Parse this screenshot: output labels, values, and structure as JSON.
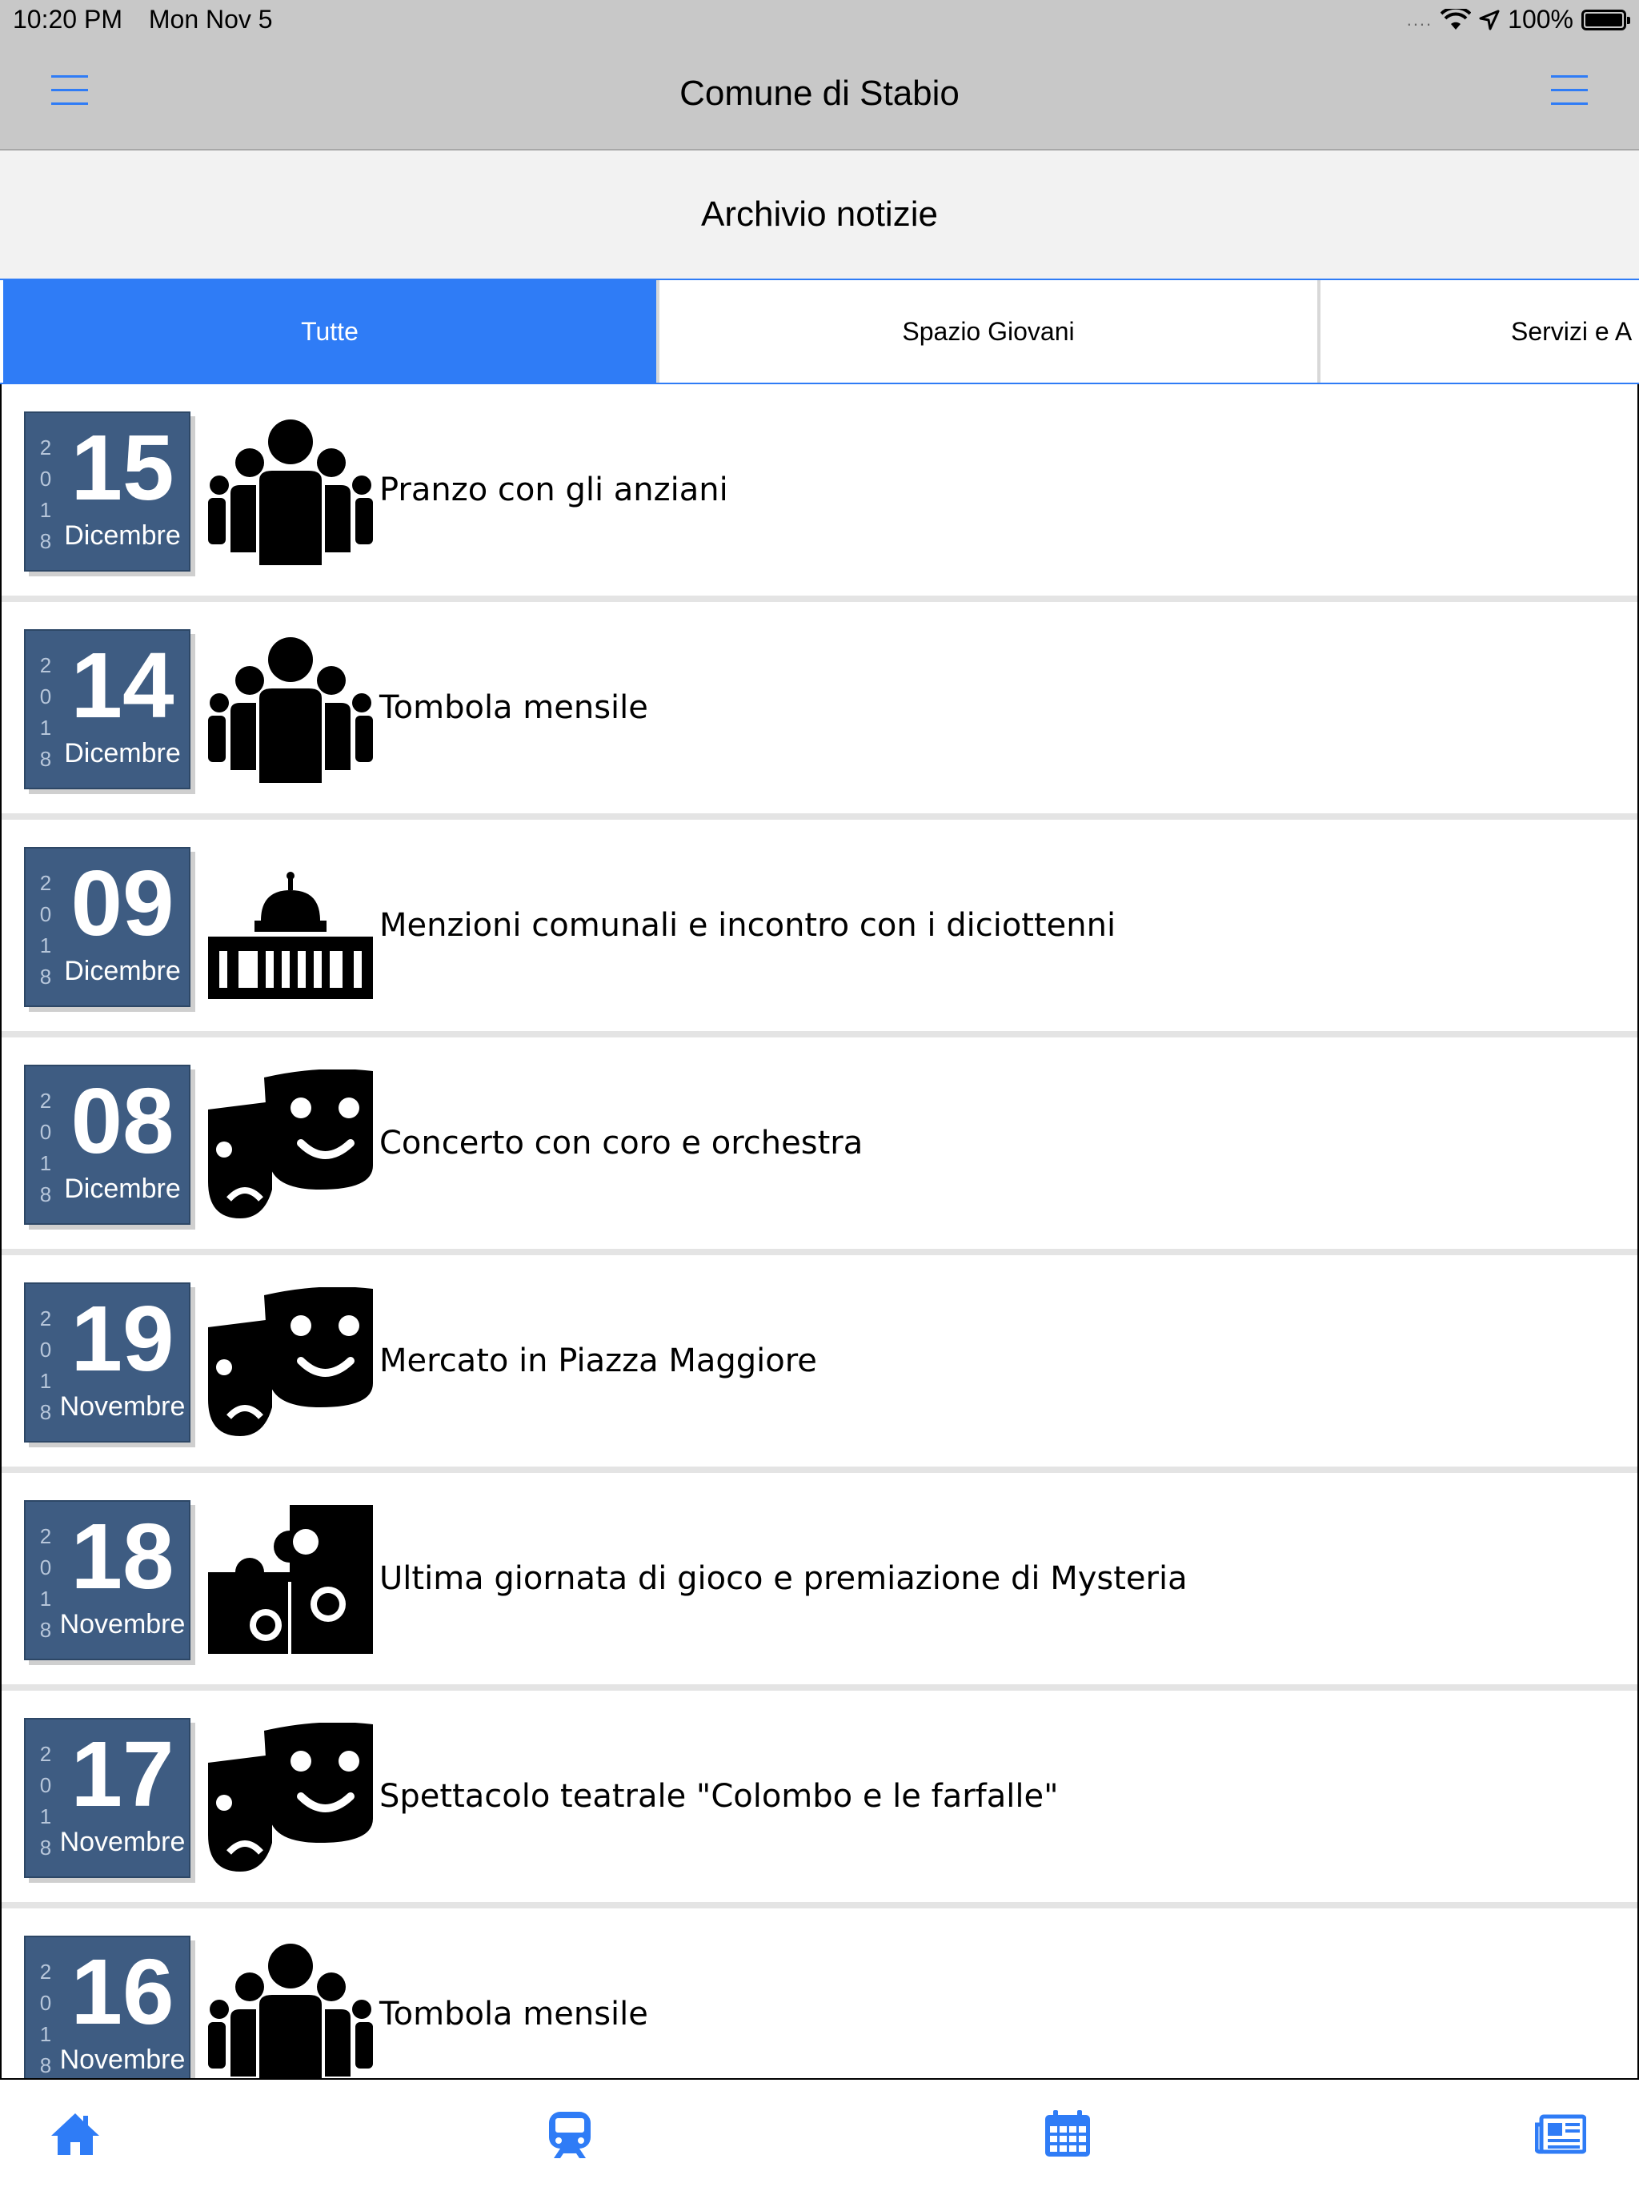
{
  "status_bar": {
    "time": "10:20 PM",
    "date": "Mon Nov 5",
    "signal_dots": "....",
    "battery_percent": "100%",
    "battery_level": 1.0
  },
  "navbar": {
    "title": "Comune di Stabio",
    "left_icon": "menu-icon",
    "right_icon": "menu-icon"
  },
  "section": {
    "title": "Archivio notizie"
  },
  "tabs": [
    {
      "label": "Tutte",
      "active": true
    },
    {
      "label": "Spazio Giovani",
      "active": false
    },
    {
      "label": "Servizi e A",
      "active": false
    }
  ],
  "news": [
    {
      "day": "15",
      "month": "Dicembre",
      "year": [
        "2",
        "0",
        "1",
        "8"
      ],
      "category_icon": "people-group-icon",
      "title": "Pranzo con gli anziani"
    },
    {
      "day": "14",
      "month": "Dicembre",
      "year": [
        "2",
        "0",
        "1",
        "8"
      ],
      "category_icon": "people-group-icon",
      "title": "Tombola mensile"
    },
    {
      "day": "09",
      "month": "Dicembre",
      "year": [
        "2",
        "0",
        "1",
        "8"
      ],
      "category_icon": "town-hall-icon",
      "title": "Menzioni comunali e incontro con i diciottenni"
    },
    {
      "day": "08",
      "month": "Dicembre",
      "year": [
        "2",
        "0",
        "1",
        "8"
      ],
      "category_icon": "theater-masks-icon",
      "title": "Concerto con coro e orchestra"
    },
    {
      "day": "19",
      "month": "Novembre",
      "year": [
        "2",
        "0",
        "1",
        "8"
      ],
      "category_icon": "theater-masks-icon",
      "title": "Mercato in Piazza Maggiore"
    },
    {
      "day": "18",
      "month": "Novembre",
      "year": [
        "2",
        "0",
        "1",
        "8"
      ],
      "category_icon": "puzzle-icon",
      "title": "Ultima giornata di gioco e premiazione di Mysteria"
    },
    {
      "day": "17",
      "month": "Novembre",
      "year": [
        "2",
        "0",
        "1",
        "8"
      ],
      "category_icon": "theater-masks-icon",
      "title": "Spettacolo teatrale \"Colombo e le farfalle\""
    },
    {
      "day": "16",
      "month": "Novembre",
      "year": [
        "2",
        "0",
        "1",
        "8"
      ],
      "category_icon": "people-group-icon",
      "title": "Tombola mensile"
    }
  ],
  "bottom_tabs": [
    {
      "icon": "home-icon"
    },
    {
      "icon": "train-icon"
    },
    {
      "icon": "calendar-icon"
    },
    {
      "icon": "newspaper-icon"
    }
  ],
  "colors": {
    "accent": "#2f7cf6",
    "bars": "#c8c8c8",
    "date_box": "#3e5c82"
  }
}
